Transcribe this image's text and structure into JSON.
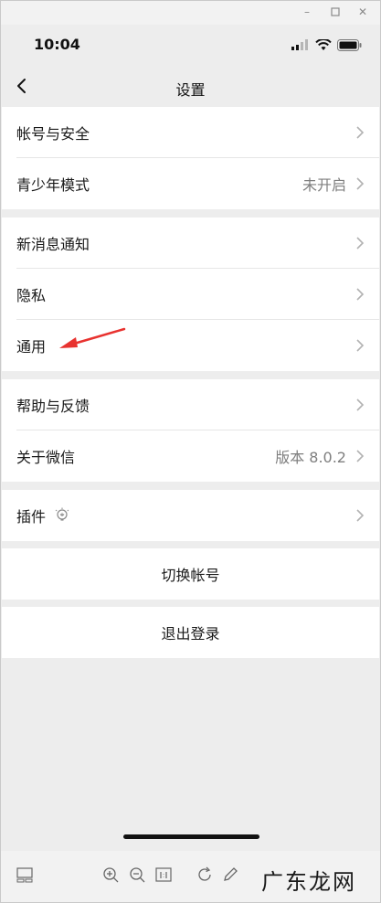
{
  "status_bar": {
    "time": "10:04"
  },
  "navbar": {
    "title": "设置"
  },
  "groups": [
    {
      "items": [
        {
          "label": "帐号与安全",
          "value": ""
        },
        {
          "label": "青少年模式",
          "value": "未开启"
        }
      ]
    },
    {
      "items": [
        {
          "label": "新消息通知",
          "value": ""
        },
        {
          "label": "隐私",
          "value": ""
        },
        {
          "label": "通用",
          "value": ""
        }
      ]
    },
    {
      "items": [
        {
          "label": "帮助与反馈",
          "value": ""
        },
        {
          "label": "关于微信",
          "value": "版本 8.0.2"
        }
      ]
    },
    {
      "items": [
        {
          "label": "插件",
          "value": ""
        }
      ]
    }
  ],
  "actions": {
    "switch_account": "切换帐号",
    "logout": "退出登录"
  },
  "watermark": "广东龙网",
  "colors": {
    "background": "#ededed",
    "card": "#ffffff",
    "annotation_arrow": "#e8322f"
  }
}
